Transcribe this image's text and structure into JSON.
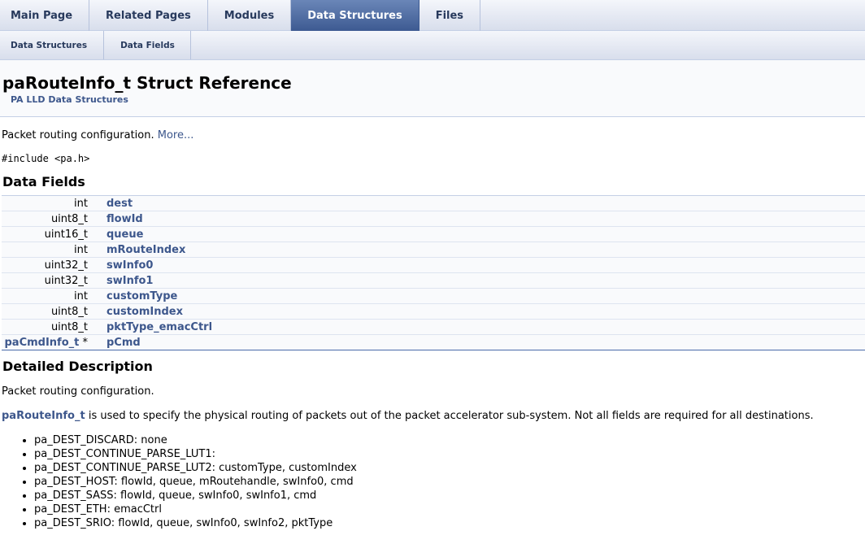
{
  "tabs": [
    {
      "label": "Main Page",
      "active": false
    },
    {
      "label": "Related Pages",
      "active": false
    },
    {
      "label": "Modules",
      "active": false
    },
    {
      "label": "Data Structures",
      "active": true
    },
    {
      "label": "Files",
      "active": false
    }
  ],
  "subtabs": [
    {
      "label": "Data Structures"
    },
    {
      "label": "Data Fields"
    }
  ],
  "header": {
    "title": "paRouteInfo_t Struct Reference",
    "group": "PA LLD Data Structures"
  },
  "brief": {
    "text": "Packet routing configuration. ",
    "more": "More..."
  },
  "include": "#include <pa.h>",
  "data_fields_heading": "Data Fields",
  "fields": [
    {
      "type": "int",
      "type_link": false,
      "name": "dest"
    },
    {
      "type": "uint8_t",
      "type_link": false,
      "name": "flowId"
    },
    {
      "type": "uint16_t",
      "type_link": false,
      "name": "queue"
    },
    {
      "type": "int",
      "type_link": false,
      "name": "mRouteIndex"
    },
    {
      "type": "uint32_t",
      "type_link": false,
      "name": "swInfo0"
    },
    {
      "type": "uint32_t",
      "type_link": false,
      "name": "swInfo1"
    },
    {
      "type": "int",
      "type_link": false,
      "name": "customType"
    },
    {
      "type": "uint8_t",
      "type_link": false,
      "name": "customIndex"
    },
    {
      "type": "uint8_t",
      "type_link": false,
      "name": "pktType_emacCtrl"
    },
    {
      "type": "paCmdInfo_t",
      "type_suffix": " *",
      "type_link": true,
      "name": "pCmd"
    }
  ],
  "detailed": {
    "heading": "Detailed Description",
    "para1": "Packet routing configuration.",
    "para2_link": "paRouteInfo_t",
    "para2_text": " is used to specify the physical routing of packets out of the packet accelerator sub-system. Not all fields are required for all destinations.",
    "items": [
      "pa_DEST_DISCARD: none",
      "pa_DEST_CONTINUE_PARSE_LUT1:",
      "pa_DEST_CONTINUE_PARSE_LUT2: customType, customIndex",
      "pa_DEST_HOST: flowId, queue, mRoutehandle, swInfo0, cmd",
      "pa_DEST_SASS: flowId, queue, swInfo0, swInfo1, cmd",
      "pa_DEST_ETH: emacCtrl",
      "pa_DEST_SRIO: flowId, queue, swInfo0, swInfo2, pktType"
    ]
  }
}
